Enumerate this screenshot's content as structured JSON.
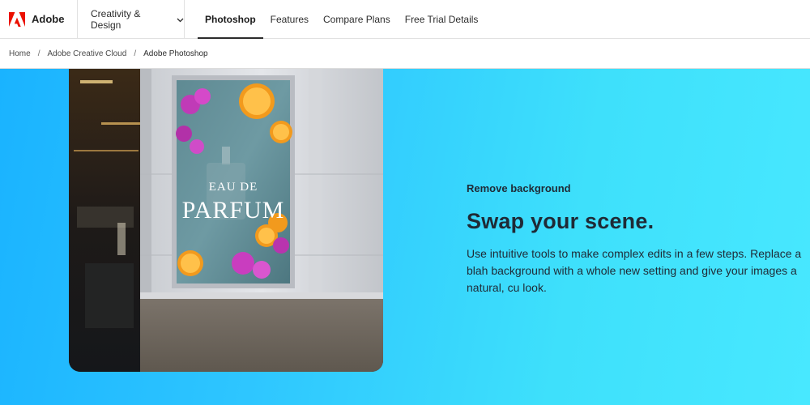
{
  "nav": {
    "brand": "Adobe",
    "category_menu": "Creativity & Design",
    "links": [
      {
        "label": "Photoshop",
        "active": true
      },
      {
        "label": "Features",
        "active": false
      },
      {
        "label": "Compare Plans",
        "active": false
      },
      {
        "label": "Free Trial Details",
        "active": false
      }
    ]
  },
  "breadcrumb": {
    "items": [
      "Home",
      "Adobe Creative Cloud",
      "Adobe Photoshop"
    ],
    "separator": "/"
  },
  "hero": {
    "eyebrow": "Remove background",
    "headline": "Swap your scene.",
    "body": "Use intuitive tools to make complex edits in a few steps. Replace a blah background with a whole new setting and give your images a natural, cu look.",
    "poster_text_top": "EAU DE",
    "poster_text_bottom": "PARFUM"
  },
  "colors": {
    "brand_red": "#eb1000",
    "hero_gradient_start": "#1ab3ff",
    "hero_gradient_end": "#48e8ff",
    "text_dark": "#1f2a36"
  },
  "icons": [
    "adobe-logo-icon",
    "chevron-down-icon"
  ]
}
